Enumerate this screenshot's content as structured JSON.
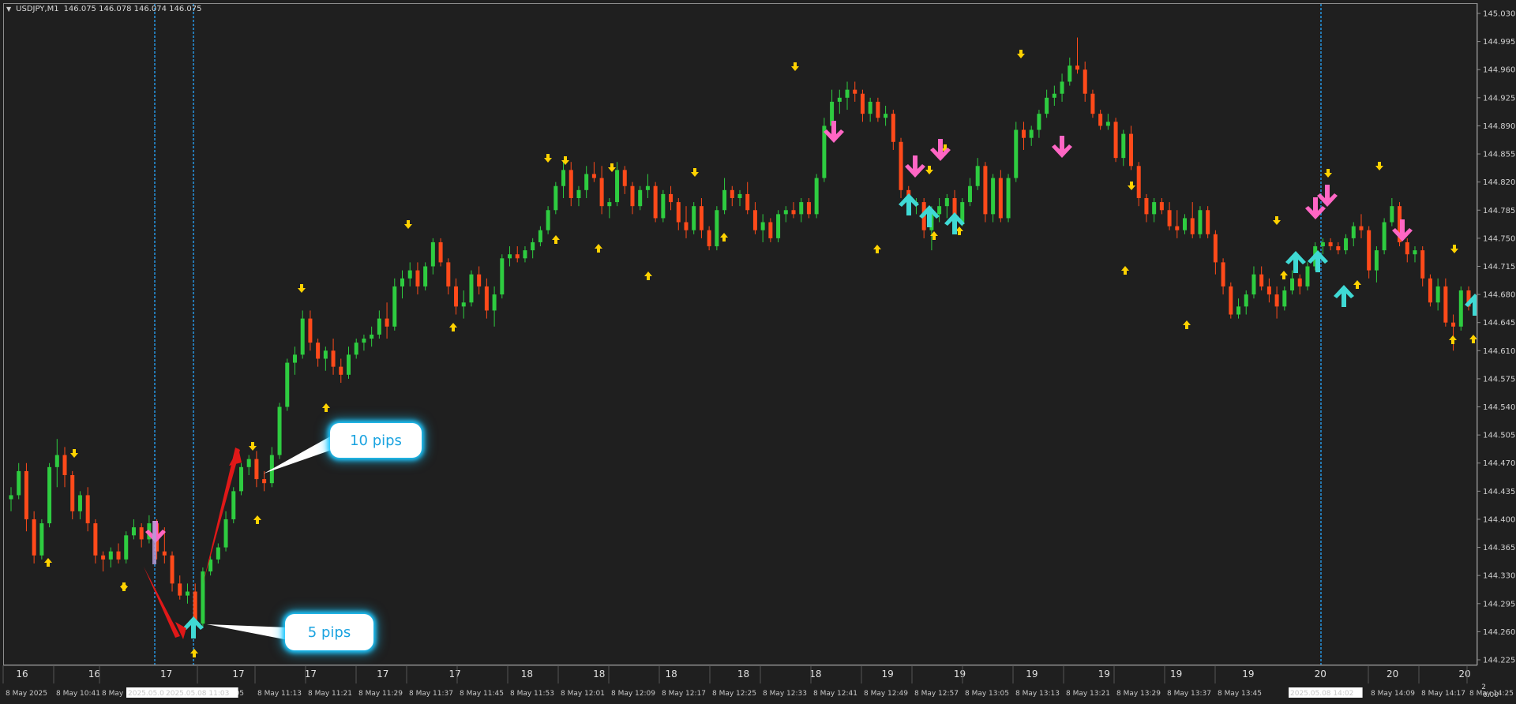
{
  "window": {
    "symbol_title": "USDJPY,M1",
    "ohlc": "146.075 146.078 146.074 146.075"
  },
  "price_axis": {
    "labels": [
      "145.030",
      "144.995",
      "144.960",
      "144.925",
      "144.890",
      "144.855",
      "144.820",
      "144.785",
      "144.750",
      "144.715",
      "144.680",
      "144.645",
      "144.610",
      "144.575",
      "144.540",
      "144.505",
      "144.470",
      "144.435",
      "144.400",
      "144.365",
      "144.330",
      "144.295",
      "144.260",
      "144.225"
    ],
    "max": 145.03,
    "min": 144.225
  },
  "day_labels": [
    "16",
    "16",
    "17",
    "17",
    "17",
    "17",
    "17",
    "18",
    "18",
    "18",
    "18",
    "18",
    "19",
    "19",
    "19",
    "19",
    "19",
    "19",
    "20",
    "20",
    "20"
  ],
  "time_labels": [
    "8 May 2025",
    "8 May 10:41",
    "8 May",
    "8 May 11:05",
    "8 May 11:13",
    "8 May 11:21",
    "8 May 11:29",
    "8 May 11:37",
    "8 May 11:45",
    "8 May 11:53",
    "8 May 12:01",
    "8 May 12:09",
    "8 May 12:17",
    "8 May 12:25",
    "8 May 12:33",
    "8 May 12:41",
    "8 May 12:49",
    "8 May 12:57",
    "8 May 13:05",
    "8 May 13:13",
    "8 May 13:21",
    "8 May 13:29",
    "8 May 13:37",
    "8 May 13:45",
    "8 May 14:09",
    "8 May 14:17",
    "8 May 14:25"
  ],
  "vertical_line_labels": [
    "2025.05.08",
    "2025.05.08 11:03",
    "2025.05.08 14:02"
  ],
  "callouts": {
    "ten": "10 pips",
    "five": "5 pips"
  },
  "corner": {
    "top": "2",
    "bottom": "0.00"
  },
  "colors": {
    "bull": "#2ecc40",
    "bear": "#ff4a1a",
    "small_arrow": "#ffd200",
    "big_down": "#ff66c4",
    "big_up": "#3fd9d4",
    "vline": "#27a7ff"
  },
  "chart_data": {
    "type": "candlestick",
    "ylim": [
      144.225,
      145.03
    ],
    "candles": [
      [
        144.425,
        144.44,
        144.41,
        144.43
      ],
      [
        144.43,
        144.47,
        144.425,
        144.46
      ],
      [
        144.46,
        144.47,
        144.385,
        144.4
      ],
      [
        144.4,
        144.41,
        144.345,
        144.355
      ],
      [
        144.355,
        144.4,
        144.35,
        144.395
      ],
      [
        144.395,
        144.47,
        144.39,
        144.465
      ],
      [
        144.465,
        144.5,
        144.44,
        144.48
      ],
      [
        144.48,
        144.49,
        144.44,
        144.455
      ],
      [
        144.455,
        144.46,
        144.4,
        144.41
      ],
      [
        144.41,
        144.435,
        144.4,
        144.43
      ],
      [
        144.43,
        144.44,
        144.385,
        144.395
      ],
      [
        144.395,
        144.4,
        144.345,
        144.355
      ],
      [
        144.355,
        144.36,
        144.335,
        144.35
      ],
      [
        144.35,
        144.365,
        144.34,
        144.36
      ],
      [
        144.36,
        144.37,
        144.345,
        144.35
      ],
      [
        144.35,
        144.385,
        144.345,
        144.38
      ],
      [
        144.38,
        144.4,
        144.375,
        144.39
      ],
      [
        144.39,
        144.395,
        144.365,
        144.375
      ],
      [
        144.375,
        144.405,
        144.37,
        144.395
      ],
      [
        144.395,
        144.4,
        144.35,
        144.36
      ],
      [
        144.36,
        144.39,
        144.345,
        144.355
      ],
      [
        144.355,
        144.36,
        144.31,
        144.32
      ],
      [
        144.32,
        144.33,
        144.3,
        144.305
      ],
      [
        144.305,
        144.32,
        144.295,
        144.31
      ],
      [
        144.31,
        144.32,
        144.26,
        144.27
      ],
      [
        144.27,
        144.34,
        144.265,
        144.335
      ],
      [
        144.335,
        144.355,
        144.33,
        144.35
      ],
      [
        144.35,
        144.37,
        144.345,
        144.365
      ],
      [
        144.365,
        144.41,
        144.36,
        144.4
      ],
      [
        144.4,
        144.44,
        144.395,
        144.435
      ],
      [
        144.435,
        144.47,
        144.43,
        144.465
      ],
      [
        144.465,
        144.48,
        144.455,
        144.475
      ],
      [
        144.475,
        144.485,
        144.44,
        144.45
      ],
      [
        144.45,
        144.46,
        144.435,
        144.445
      ],
      [
        144.445,
        144.49,
        144.44,
        144.48
      ],
      [
        144.48,
        144.545,
        144.475,
        144.54
      ],
      [
        144.54,
        144.6,
        144.535,
        144.595
      ],
      [
        144.595,
        144.615,
        144.58,
        144.605
      ],
      [
        144.605,
        144.66,
        144.6,
        144.65
      ],
      [
        144.65,
        144.66,
        144.61,
        144.62
      ],
      [
        144.62,
        144.625,
        144.59,
        144.6
      ],
      [
        144.6,
        144.615,
        144.585,
        144.61
      ],
      [
        144.61,
        144.625,
        144.58,
        144.59
      ],
      [
        144.59,
        144.6,
        144.57,
        144.58
      ],
      [
        144.58,
        144.615,
        144.575,
        144.605
      ],
      [
        144.605,
        144.625,
        144.6,
        144.62
      ],
      [
        144.62,
        144.63,
        144.61,
        144.625
      ],
      [
        144.625,
        144.64,
        144.615,
        144.63
      ],
      [
        144.63,
        144.66,
        144.625,
        144.65
      ],
      [
        144.65,
        144.67,
        144.625,
        144.64
      ],
      [
        144.64,
        144.7,
        144.635,
        144.69
      ],
      [
        144.69,
        144.71,
        144.675,
        144.7
      ],
      [
        144.7,
        144.72,
        144.69,
        144.71
      ],
      [
        144.71,
        144.72,
        144.68,
        144.69
      ],
      [
        144.69,
        144.72,
        144.685,
        144.715
      ],
      [
        144.715,
        144.75,
        144.705,
        144.745
      ],
      [
        144.745,
        144.75,
        144.715,
        144.72
      ],
      [
        144.72,
        144.725,
        144.68,
        144.69
      ],
      [
        144.69,
        144.7,
        144.655,
        144.665
      ],
      [
        144.665,
        144.685,
        144.65,
        144.67
      ],
      [
        144.67,
        144.71,
        144.665,
        144.705
      ],
      [
        144.705,
        144.715,
        144.68,
        144.69
      ],
      [
        144.69,
        144.7,
        144.65,
        144.66
      ],
      [
        144.66,
        144.69,
        144.64,
        144.68
      ],
      [
        144.68,
        144.73,
        144.675,
        144.725
      ],
      [
        144.725,
        144.74,
        144.715,
        144.73
      ],
      [
        144.73,
        144.74,
        144.72,
        144.725
      ],
      [
        144.725,
        144.74,
        144.72,
        144.735
      ],
      [
        144.735,
        144.75,
        144.725,
        144.745
      ],
      [
        144.745,
        144.765,
        144.74,
        144.76
      ],
      [
        144.76,
        144.79,
        144.755,
        144.785
      ],
      [
        144.785,
        144.82,
        144.78,
        144.815
      ],
      [
        144.815,
        144.845,
        144.8,
        144.835
      ],
      [
        144.835,
        144.845,
        144.79,
        144.8
      ],
      [
        144.8,
        144.815,
        144.79,
        144.81
      ],
      [
        144.81,
        144.84,
        144.8,
        144.83
      ],
      [
        144.83,
        144.845,
        144.82,
        144.825
      ],
      [
        144.825,
        144.84,
        144.78,
        144.79
      ],
      [
        144.79,
        144.8,
        144.775,
        144.795
      ],
      [
        144.795,
        144.845,
        144.79,
        144.835
      ],
      [
        144.835,
        144.84,
        144.805,
        144.815
      ],
      [
        144.815,
        144.82,
        144.78,
        144.79
      ],
      [
        144.79,
        144.815,
        144.785,
        144.81
      ],
      [
        144.81,
        144.83,
        144.8,
        144.815
      ],
      [
        144.815,
        144.82,
        144.77,
        144.775
      ],
      [
        144.775,
        144.81,
        144.77,
        144.805
      ],
      [
        144.805,
        144.815,
        144.785,
        144.795
      ],
      [
        144.795,
        144.8,
        144.76,
        144.77
      ],
      [
        144.77,
        144.79,
        144.75,
        144.76
      ],
      [
        144.76,
        144.795,
        144.755,
        144.79
      ],
      [
        144.79,
        144.8,
        144.75,
        144.76
      ],
      [
        144.76,
        144.765,
        144.735,
        144.74
      ],
      [
        144.74,
        144.79,
        144.735,
        144.785
      ],
      [
        144.785,
        144.825,
        144.78,
        144.81
      ],
      [
        144.81,
        144.815,
        144.79,
        144.8
      ],
      [
        144.8,
        144.81,
        144.79,
        144.805
      ],
      [
        144.805,
        144.82,
        144.78,
        144.785
      ],
      [
        144.785,
        144.795,
        144.755,
        144.76
      ],
      [
        144.76,
        144.78,
        144.745,
        144.77
      ],
      [
        144.77,
        144.775,
        144.745,
        144.75
      ],
      [
        144.75,
        144.785,
        144.745,
        144.78
      ],
      [
        144.78,
        144.79,
        144.77,
        144.785
      ],
      [
        144.785,
        144.795,
        144.775,
        144.78
      ],
      [
        144.78,
        144.8,
        144.77,
        144.795
      ],
      [
        144.795,
        144.8,
        144.775,
        144.78
      ],
      [
        144.78,
        144.83,
        144.775,
        144.825
      ],
      [
        144.825,
        144.9,
        144.82,
        144.89
      ],
      [
        144.89,
        144.935,
        144.88,
        144.92
      ],
      [
        144.92,
        144.935,
        144.905,
        144.925
      ],
      [
        144.925,
        144.945,
        144.91,
        144.935
      ],
      [
        144.935,
        144.945,
        144.92,
        144.93
      ],
      [
        144.93,
        144.935,
        144.895,
        144.905
      ],
      [
        144.905,
        144.925,
        144.895,
        144.92
      ],
      [
        144.92,
        144.925,
        144.895,
        144.9
      ],
      [
        144.9,
        144.915,
        144.89,
        144.905
      ],
      [
        144.905,
        144.91,
        144.86,
        144.87
      ],
      [
        144.87,
        144.875,
        144.8,
        144.81
      ],
      [
        144.81,
        144.815,
        144.79,
        144.795
      ],
      [
        144.795,
        144.8,
        144.78,
        144.795
      ],
      [
        144.795,
        144.8,
        144.75,
        144.76
      ],
      [
        144.76,
        144.79,
        144.735,
        144.78
      ],
      [
        144.78,
        144.8,
        144.77,
        144.79
      ],
      [
        144.79,
        144.805,
        144.775,
        144.8
      ],
      [
        144.8,
        144.81,
        144.76,
        144.77
      ],
      [
        144.77,
        144.8,
        144.765,
        144.795
      ],
      [
        144.795,
        144.825,
        144.79,
        144.815
      ],
      [
        144.815,
        144.85,
        144.81,
        144.84
      ],
      [
        144.84,
        144.845,
        144.77,
        144.78
      ],
      [
        144.78,
        144.83,
        144.77,
        144.825
      ],
      [
        144.825,
        144.835,
        144.77,
        144.775
      ],
      [
        144.775,
        144.83,
        144.77,
        144.825
      ],
      [
        144.825,
        144.895,
        144.82,
        144.885
      ],
      [
        144.885,
        144.895,
        144.86,
        144.875
      ],
      [
        144.875,
        144.89,
        144.865,
        144.885
      ],
      [
        144.885,
        144.91,
        144.875,
        144.905
      ],
      [
        144.905,
        144.935,
        144.9,
        144.925
      ],
      [
        144.925,
        144.94,
        144.915,
        144.93
      ],
      [
        144.93,
        144.955,
        144.92,
        144.945
      ],
      [
        144.945,
        144.975,
        144.94,
        144.965
      ],
      [
        144.965,
        145.0,
        144.955,
        144.96
      ],
      [
        144.96,
        144.97,
        144.92,
        144.93
      ],
      [
        144.93,
        144.935,
        144.9,
        144.905
      ],
      [
        144.905,
        144.91,
        144.885,
        144.89
      ],
      [
        144.89,
        144.905,
        144.885,
        144.895
      ],
      [
        144.895,
        144.9,
        144.845,
        144.85
      ],
      [
        144.85,
        144.885,
        144.84,
        144.88
      ],
      [
        144.88,
        144.89,
        144.835,
        144.84
      ],
      [
        144.84,
        144.845,
        144.79,
        144.8
      ],
      [
        144.8,
        144.805,
        144.77,
        144.78
      ],
      [
        144.78,
        144.8,
        144.77,
        144.795
      ],
      [
        144.795,
        144.8,
        144.78,
        144.785
      ],
      [
        144.785,
        144.795,
        144.76,
        144.765
      ],
      [
        144.765,
        144.785,
        144.75,
        144.76
      ],
      [
        144.76,
        144.78,
        144.755,
        144.775
      ],
      [
        144.775,
        144.795,
        144.75,
        144.755
      ],
      [
        144.755,
        144.79,
        144.75,
        144.785
      ],
      [
        144.785,
        144.79,
        144.75,
        144.755
      ],
      [
        144.755,
        144.76,
        144.705,
        144.72
      ],
      [
        144.72,
        144.725,
        144.68,
        144.69
      ],
      [
        144.69,
        144.695,
        144.65,
        144.655
      ],
      [
        144.655,
        144.675,
        144.65,
        144.665
      ],
      [
        144.665,
        144.685,
        144.655,
        144.68
      ],
      [
        144.68,
        144.715,
        144.675,
        144.705
      ],
      [
        144.705,
        144.715,
        144.685,
        144.69
      ],
      [
        144.69,
        144.7,
        144.67,
        144.68
      ],
      [
        144.68,
        144.69,
        144.65,
        144.665
      ],
      [
        144.665,
        144.69,
        144.66,
        144.685
      ],
      [
        144.685,
        144.71,
        144.68,
        144.7
      ],
      [
        144.7,
        144.705,
        144.68,
        144.69
      ],
      [
        144.69,
        144.72,
        144.685,
        144.715
      ],
      [
        144.715,
        144.745,
        144.71,
        144.74
      ],
      [
        144.74,
        144.75,
        144.73,
        144.745
      ],
      [
        144.745,
        144.75,
        144.735,
        144.74
      ],
      [
        144.74,
        144.745,
        144.73,
        144.735
      ],
      [
        144.735,
        144.755,
        144.73,
        144.75
      ],
      [
        144.75,
        144.77,
        144.74,
        144.765
      ],
      [
        144.765,
        144.78,
        144.75,
        144.76
      ],
      [
        144.76,
        144.765,
        144.7,
        144.71
      ],
      [
        144.71,
        144.74,
        144.695,
        144.735
      ],
      [
        144.735,
        144.775,
        144.73,
        144.77
      ],
      [
        144.77,
        144.8,
        144.765,
        144.79
      ],
      [
        144.79,
        144.795,
        144.74,
        144.745
      ],
      [
        144.745,
        144.75,
        144.72,
        144.73
      ],
      [
        144.73,
        144.74,
        144.72,
        144.735
      ],
      [
        144.735,
        144.74,
        144.69,
        144.7
      ],
      [
        144.7,
        144.705,
        144.665,
        144.67
      ],
      [
        144.67,
        144.7,
        144.66,
        144.69
      ],
      [
        144.69,
        144.7,
        144.64,
        144.645
      ],
      [
        144.645,
        144.655,
        144.61,
        144.64
      ],
      [
        144.64,
        144.69,
        144.635,
        144.685
      ],
      [
        144.685,
        144.69,
        144.66,
        144.665
      ]
    ]
  }
}
